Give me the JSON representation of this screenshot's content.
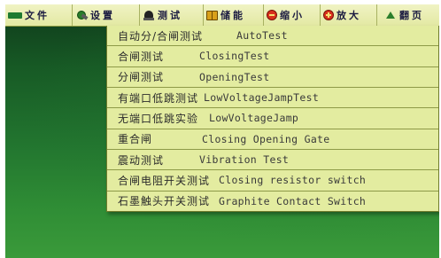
{
  "menubar": {
    "items": [
      {
        "label": "文件",
        "icon": "file-icon"
      },
      {
        "label": "设置",
        "icon": "settings-icon"
      },
      {
        "label": "测试",
        "icon": "test-icon"
      },
      {
        "label": "储能",
        "icon": "storage-icon"
      },
      {
        "label": "缩小",
        "icon": "zoom-out-icon"
      },
      {
        "label": "放大",
        "icon": "zoom-in-icon"
      },
      {
        "label": "翻页",
        "icon": "page-icon"
      }
    ]
  },
  "dropdown": {
    "items": [
      {
        "cn": "自动分/合闸测试",
        "en": "AutoTest"
      },
      {
        "cn": "合闸测试",
        "en": "ClosingTest"
      },
      {
        "cn": "分闸测试",
        "en": "OpeningTest"
      },
      {
        "cn": "有端口低跳测试",
        "en": "LowVoltageJampTest"
      },
      {
        "cn": "无端口低跳实验",
        "en": "LowVoltageJamp"
      },
      {
        "cn": "重合闸",
        "en": "Closing Opening Gate"
      },
      {
        "cn": "震动测试",
        "en": "Vibration Test"
      },
      {
        "cn": "合闸电阻开关测试",
        "en": "Closing resistor switch"
      },
      {
        "cn": "石墨触头开关测试",
        "en": "Graphite Contact Switch"
      }
    ]
  },
  "colors": {
    "menubar_bg": "#e3e9a3",
    "dropdown_bg": "#e3eca0",
    "screen_bg": "#1f6a2b"
  }
}
